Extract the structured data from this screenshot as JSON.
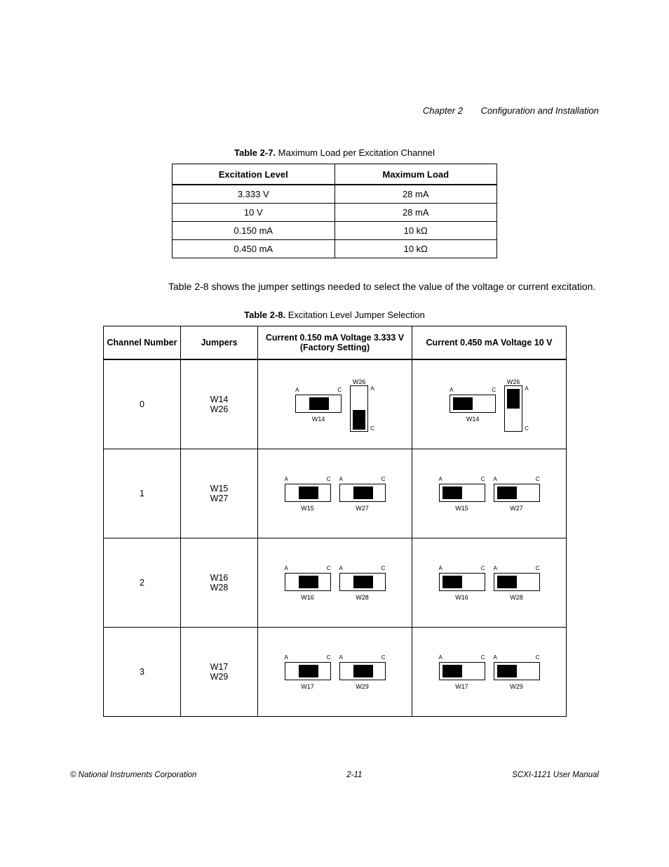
{
  "header": {
    "chapter": "Chapter 2",
    "title": "Configuration and Installation"
  },
  "table27": {
    "caption_label": "Table 2-7.",
    "caption_text": "Maximum Load per Excitation Channel",
    "head": {
      "c0": "Excitation Level",
      "c1": "Maximum Load"
    },
    "rows": [
      {
        "c0": "3.333 V",
        "c1": "28 mA"
      },
      {
        "c0": "10 V",
        "c1": "28 mA"
      },
      {
        "c0": "0.150 mA",
        "c1": "10 kΩ"
      },
      {
        "c0": "0.450 mA",
        "c1": "10 kΩ"
      }
    ]
  },
  "mid_paragraph": "Table 2-8 shows the jumper settings needed to select the value of the voltage or current excitation.",
  "table28": {
    "caption_label": "Table 2-8.",
    "caption_text": "Excitation Level Jumper Selection",
    "head": {
      "c0": "Channel Number",
      "c1": "Jumpers",
      "c2": "Current 0.150 mA Voltage 3.333 V (Factory Setting)",
      "c3": "Current 0.450 mA Voltage 10 V"
    },
    "rows": [
      {
        "channel": "0",
        "jumpers_line1": "W14",
        "jumpers_line2": "W26",
        "leftA_name": "W14",
        "leftA_pinL": "A",
        "leftA_pinR": "C",
        "leftB_name": "W26",
        "leftB_pinT": "A",
        "leftB_pinB": "C",
        "rightA_name": "W14",
        "rightA_pinL": "A",
        "rightA_pinR": "C",
        "rightB_name": "W26",
        "rightB_pinT": "A",
        "rightB_pinB": "C"
      },
      {
        "channel": "1",
        "jumpers_line1": "W15",
        "jumpers_line2": "W27",
        "leftA_name": "W15",
        "leftA_pinL": "A",
        "leftA_pinR": "C",
        "leftB_name": "W27",
        "leftB_pinL": "A",
        "leftB_pinR": "C",
        "rightA_name": "W15",
        "rightA_pinL": "A",
        "rightA_pinR": "C",
        "rightB_name": "W27",
        "rightB_pinL": "A",
        "rightB_pinR": "C"
      },
      {
        "channel": "2",
        "jumpers_line1": "W16",
        "jumpers_line2": "W28",
        "leftA_name": "W16",
        "leftA_pinL": "A",
        "leftA_pinR": "C",
        "leftB_name": "W28",
        "leftB_pinL": "A",
        "leftB_pinR": "C",
        "rightA_name": "W16",
        "rightA_pinL": "A",
        "rightA_pinR": "C",
        "rightB_name": "W28",
        "rightB_pinL": "A",
        "rightB_pinR": "C"
      },
      {
        "channel": "3",
        "jumpers_line1": "W17",
        "jumpers_line2": "W29",
        "leftA_name": "W17",
        "leftA_pinL": "A",
        "leftA_pinR": "C",
        "leftB_name": "W29",
        "leftB_pinL": "A",
        "leftB_pinR": "C",
        "rightA_name": "W17",
        "rightA_pinL": "A",
        "rightA_pinR": "C",
        "rightB_name": "W29",
        "rightB_pinL": "A",
        "rightB_pinR": "C"
      }
    ]
  },
  "footer": {
    "left": "© National Instruments Corporation",
    "center": "2-11",
    "right": "SCXI-1121 User Manual"
  }
}
